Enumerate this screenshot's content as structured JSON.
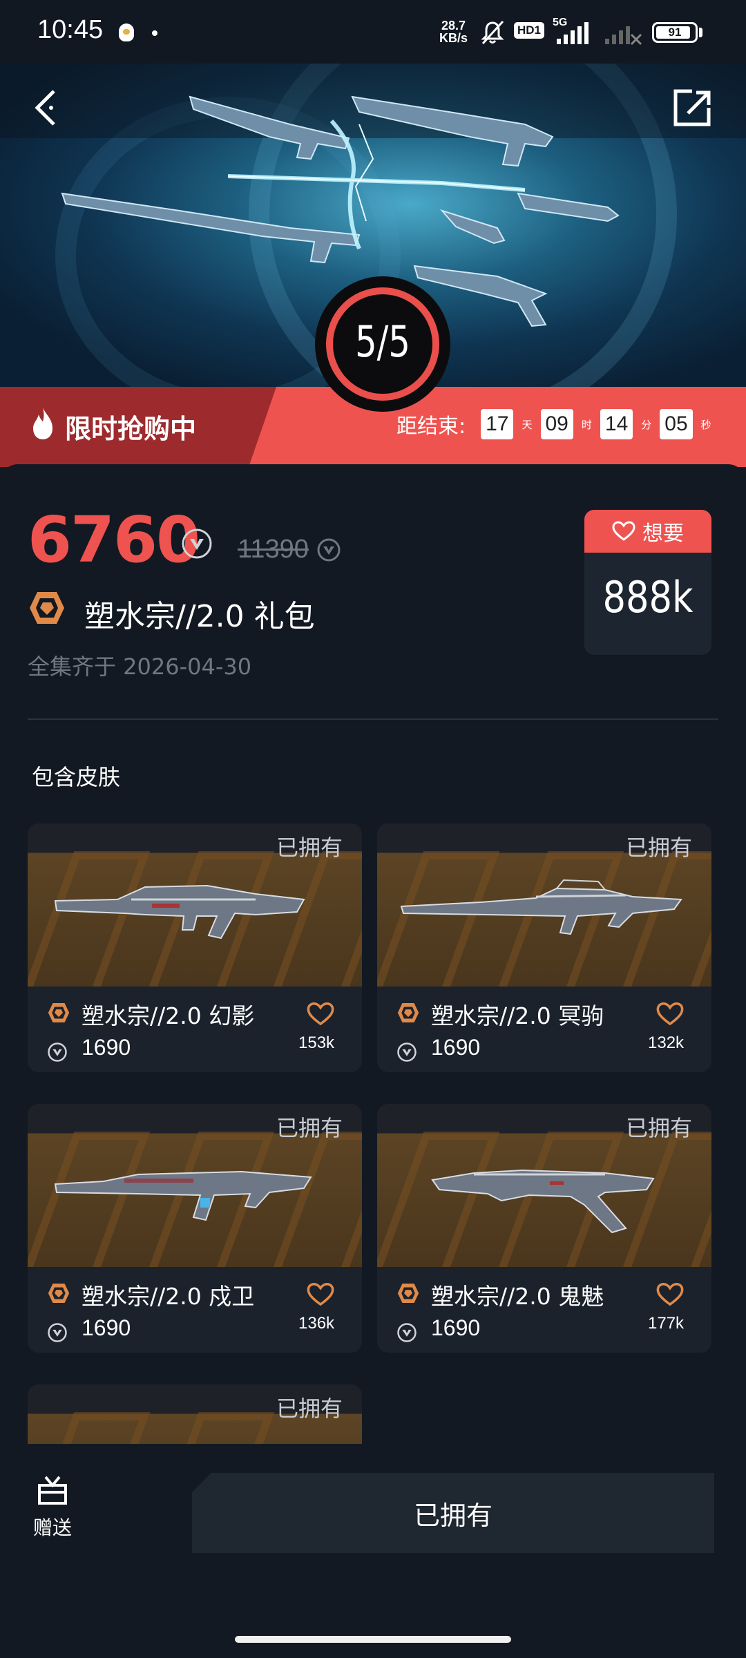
{
  "status_bar": {
    "time": "10:45",
    "net_speed_value": "28.7",
    "net_speed_unit": "KB/s",
    "hd_badge": "HD1",
    "network": "5G",
    "battery": "91",
    "battery_level": 0.91
  },
  "hero": {
    "collection_count": "5/5",
    "icons": [
      "back-icon",
      "share-icon"
    ]
  },
  "flash_sale": {
    "label": "限时抢购中",
    "countdown_label": "距结束:",
    "days": "17",
    "days_unit": "天",
    "hours": "09",
    "hours_unit": "时",
    "minutes": "14",
    "minutes_unit": "分",
    "seconds": "05",
    "seconds_unit": "秒"
  },
  "bundle": {
    "price": "6760",
    "original_price": "11390",
    "name": "塑水宗//2.0 礼包",
    "collect_date": "全集齐于 2026-04-30",
    "want_label": "想要",
    "want_count": "888k"
  },
  "skins_section_title": "包含皮肤",
  "skins": [
    {
      "owned": "已拥有",
      "name": "塑水宗//2.0 幻影",
      "price": "1690",
      "likes": "153k"
    },
    {
      "owned": "已拥有",
      "name": "塑水宗//2.0 冥驹",
      "price": "1690",
      "likes": "132k"
    },
    {
      "owned": "已拥有",
      "name": "塑水宗//2.0 戍卫",
      "price": "1690",
      "likes": "136k"
    },
    {
      "owned": "已拥有",
      "name": "塑水宗//2.0 鬼魅",
      "price": "1690",
      "likes": "177k"
    },
    {
      "owned": "已拥有"
    }
  ],
  "bottom": {
    "gift_label": "赠送",
    "owned_button": "已拥有"
  },
  "colors": {
    "accent_red": "#ef5350",
    "dark_red": "#9d2b2e",
    "tier_orange": "#e08a4a",
    "background": "#131922",
    "card": "#1b222c"
  }
}
